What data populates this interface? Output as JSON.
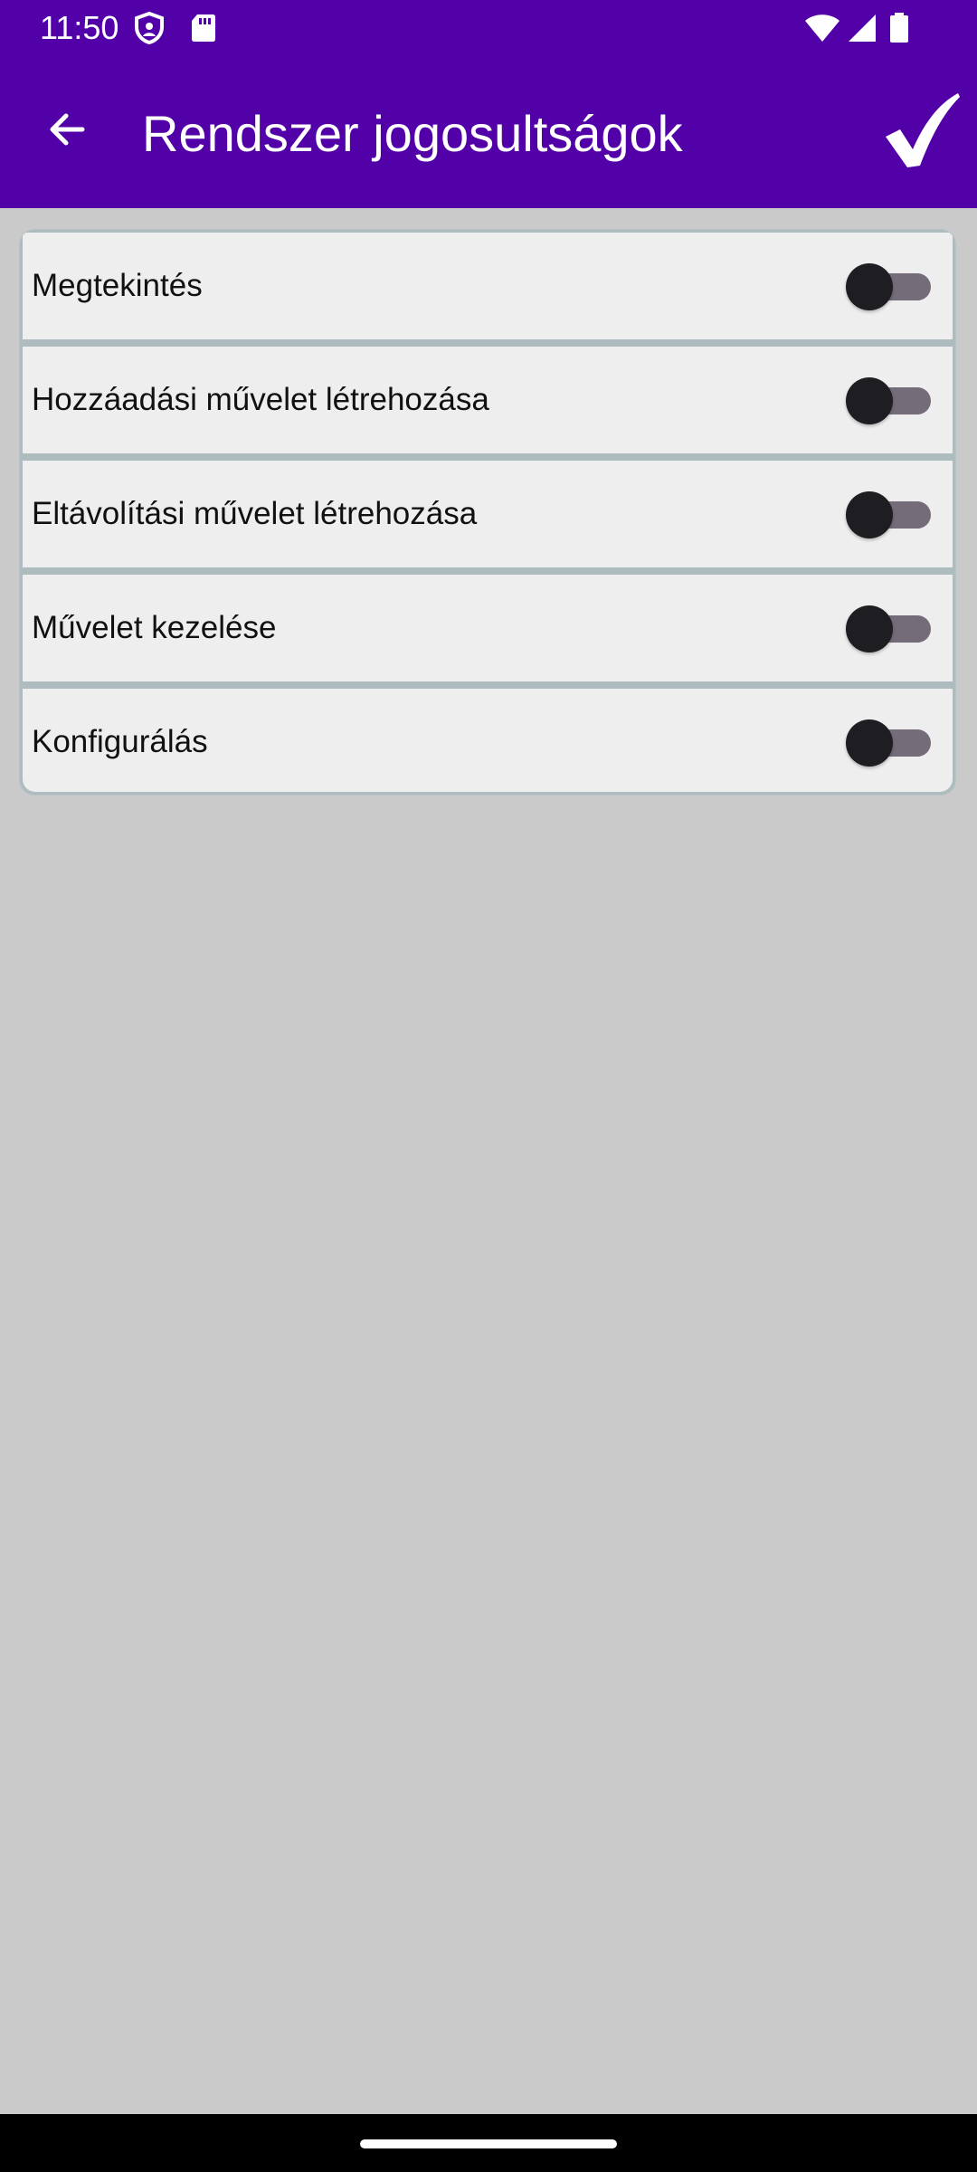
{
  "status_bar": {
    "time": "11:50",
    "icons": [
      "shield-icon",
      "sd-card-icon",
      "wifi-icon",
      "cellular-signal-icon",
      "battery-icon"
    ]
  },
  "toolbar": {
    "back_icon": "arrow-left-icon",
    "title": "Rendszer jogosultságok",
    "confirm_icon": "checkmark-icon",
    "background_color": "#5200a8"
  },
  "permissions": [
    {
      "label": "Megtekintés",
      "enabled": false
    },
    {
      "label": "Hozzáadási művelet létrehozása",
      "enabled": false
    },
    {
      "label": "Eltávolítási művelet létrehozása",
      "enabled": false
    },
    {
      "label": "Művelet kezelése",
      "enabled": false
    },
    {
      "label": "Konfigurálás",
      "enabled": false
    }
  ],
  "colors": {
    "background": "#cacaca",
    "row_background": "#eeeeee",
    "switch_thumb": "#1e1d22",
    "switch_track": "#746c78"
  }
}
